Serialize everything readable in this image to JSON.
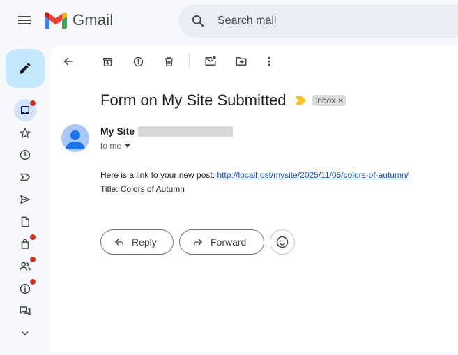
{
  "app": {
    "name": "Gmail"
  },
  "search": {
    "placeholder": "Search mail"
  },
  "email": {
    "subject": "Form on My Site Submitted",
    "label": "Inbox",
    "label_remove": "×",
    "sender_name": "My Site",
    "recipient": "to me",
    "body_line1_prefix": "Here is a link to your new post: ",
    "body_link": "http://localhost/mysite/2025/11/05/colors-of-autumn/",
    "body_line2": "Title: Colors of Autumn"
  },
  "actions": {
    "reply": "Reply",
    "forward": "Forward"
  },
  "colors": {
    "accent": "#c2e7ff",
    "active_rail": "#d3e3fd",
    "notification": "#d93025",
    "link": "#1155cc",
    "importance": "#f4c430"
  },
  "rail": [
    {
      "icon": "inbox-icon",
      "badge": true
    },
    {
      "icon": "star-icon",
      "badge": false
    },
    {
      "icon": "clock-icon",
      "badge": false
    },
    {
      "icon": "important-icon",
      "badge": false
    },
    {
      "icon": "send-icon",
      "badge": false
    },
    {
      "icon": "draft-icon",
      "badge": false
    },
    {
      "icon": "shopping-icon",
      "badge": true
    },
    {
      "icon": "people-icon",
      "badge": true
    },
    {
      "icon": "info-icon",
      "badge": true
    },
    {
      "icon": "forum-icon",
      "badge": false
    },
    {
      "icon": "chevron-down-icon",
      "badge": false
    }
  ]
}
